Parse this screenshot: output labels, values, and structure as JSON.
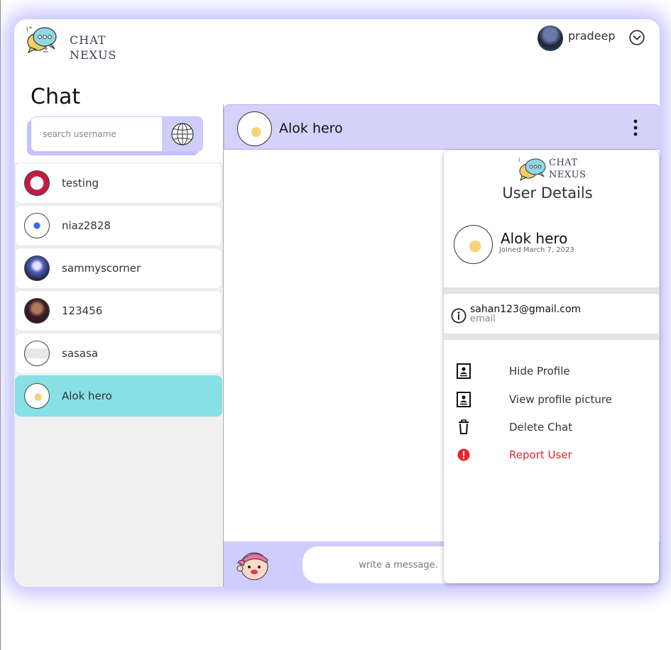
{
  "app": {
    "logo_line1": "CHAT",
    "logo_line2": "NEXUS",
    "current_user": "pradeep"
  },
  "page_title": "Chat",
  "search": {
    "placeholder": "search username"
  },
  "contacts": [
    {
      "name": "testing",
      "active": false
    },
    {
      "name": "niaz2828",
      "active": false
    },
    {
      "name": "sammyscorner",
      "active": false
    },
    {
      "name": "123456",
      "active": false
    },
    {
      "name": "sasasa",
      "active": false
    },
    {
      "name": "Alok hero",
      "active": true
    }
  ],
  "chat": {
    "contact_name": "Alok hero",
    "message_placeholder": "write a message."
  },
  "user_details": {
    "logo_line1": "CHAT",
    "logo_line2": "NEXUS",
    "title": "User Details",
    "name": "Alok hero",
    "joined": "Joined March 7, 2023",
    "email": "sahan123@gmail.com",
    "email_label": "email",
    "actions": [
      {
        "label": "Hide Profile",
        "icon": "contact-card-icon"
      },
      {
        "label": "View profile picture",
        "icon": "contact-card-icon"
      },
      {
        "label": "Delete Chat",
        "icon": "trash-icon"
      },
      {
        "label": "Report User",
        "icon": "alert-icon",
        "color": "#e8242a"
      }
    ]
  },
  "colors": {
    "accent": "#c4c1ff",
    "active_contact": "#87e0e6",
    "danger": "#e8242a"
  }
}
